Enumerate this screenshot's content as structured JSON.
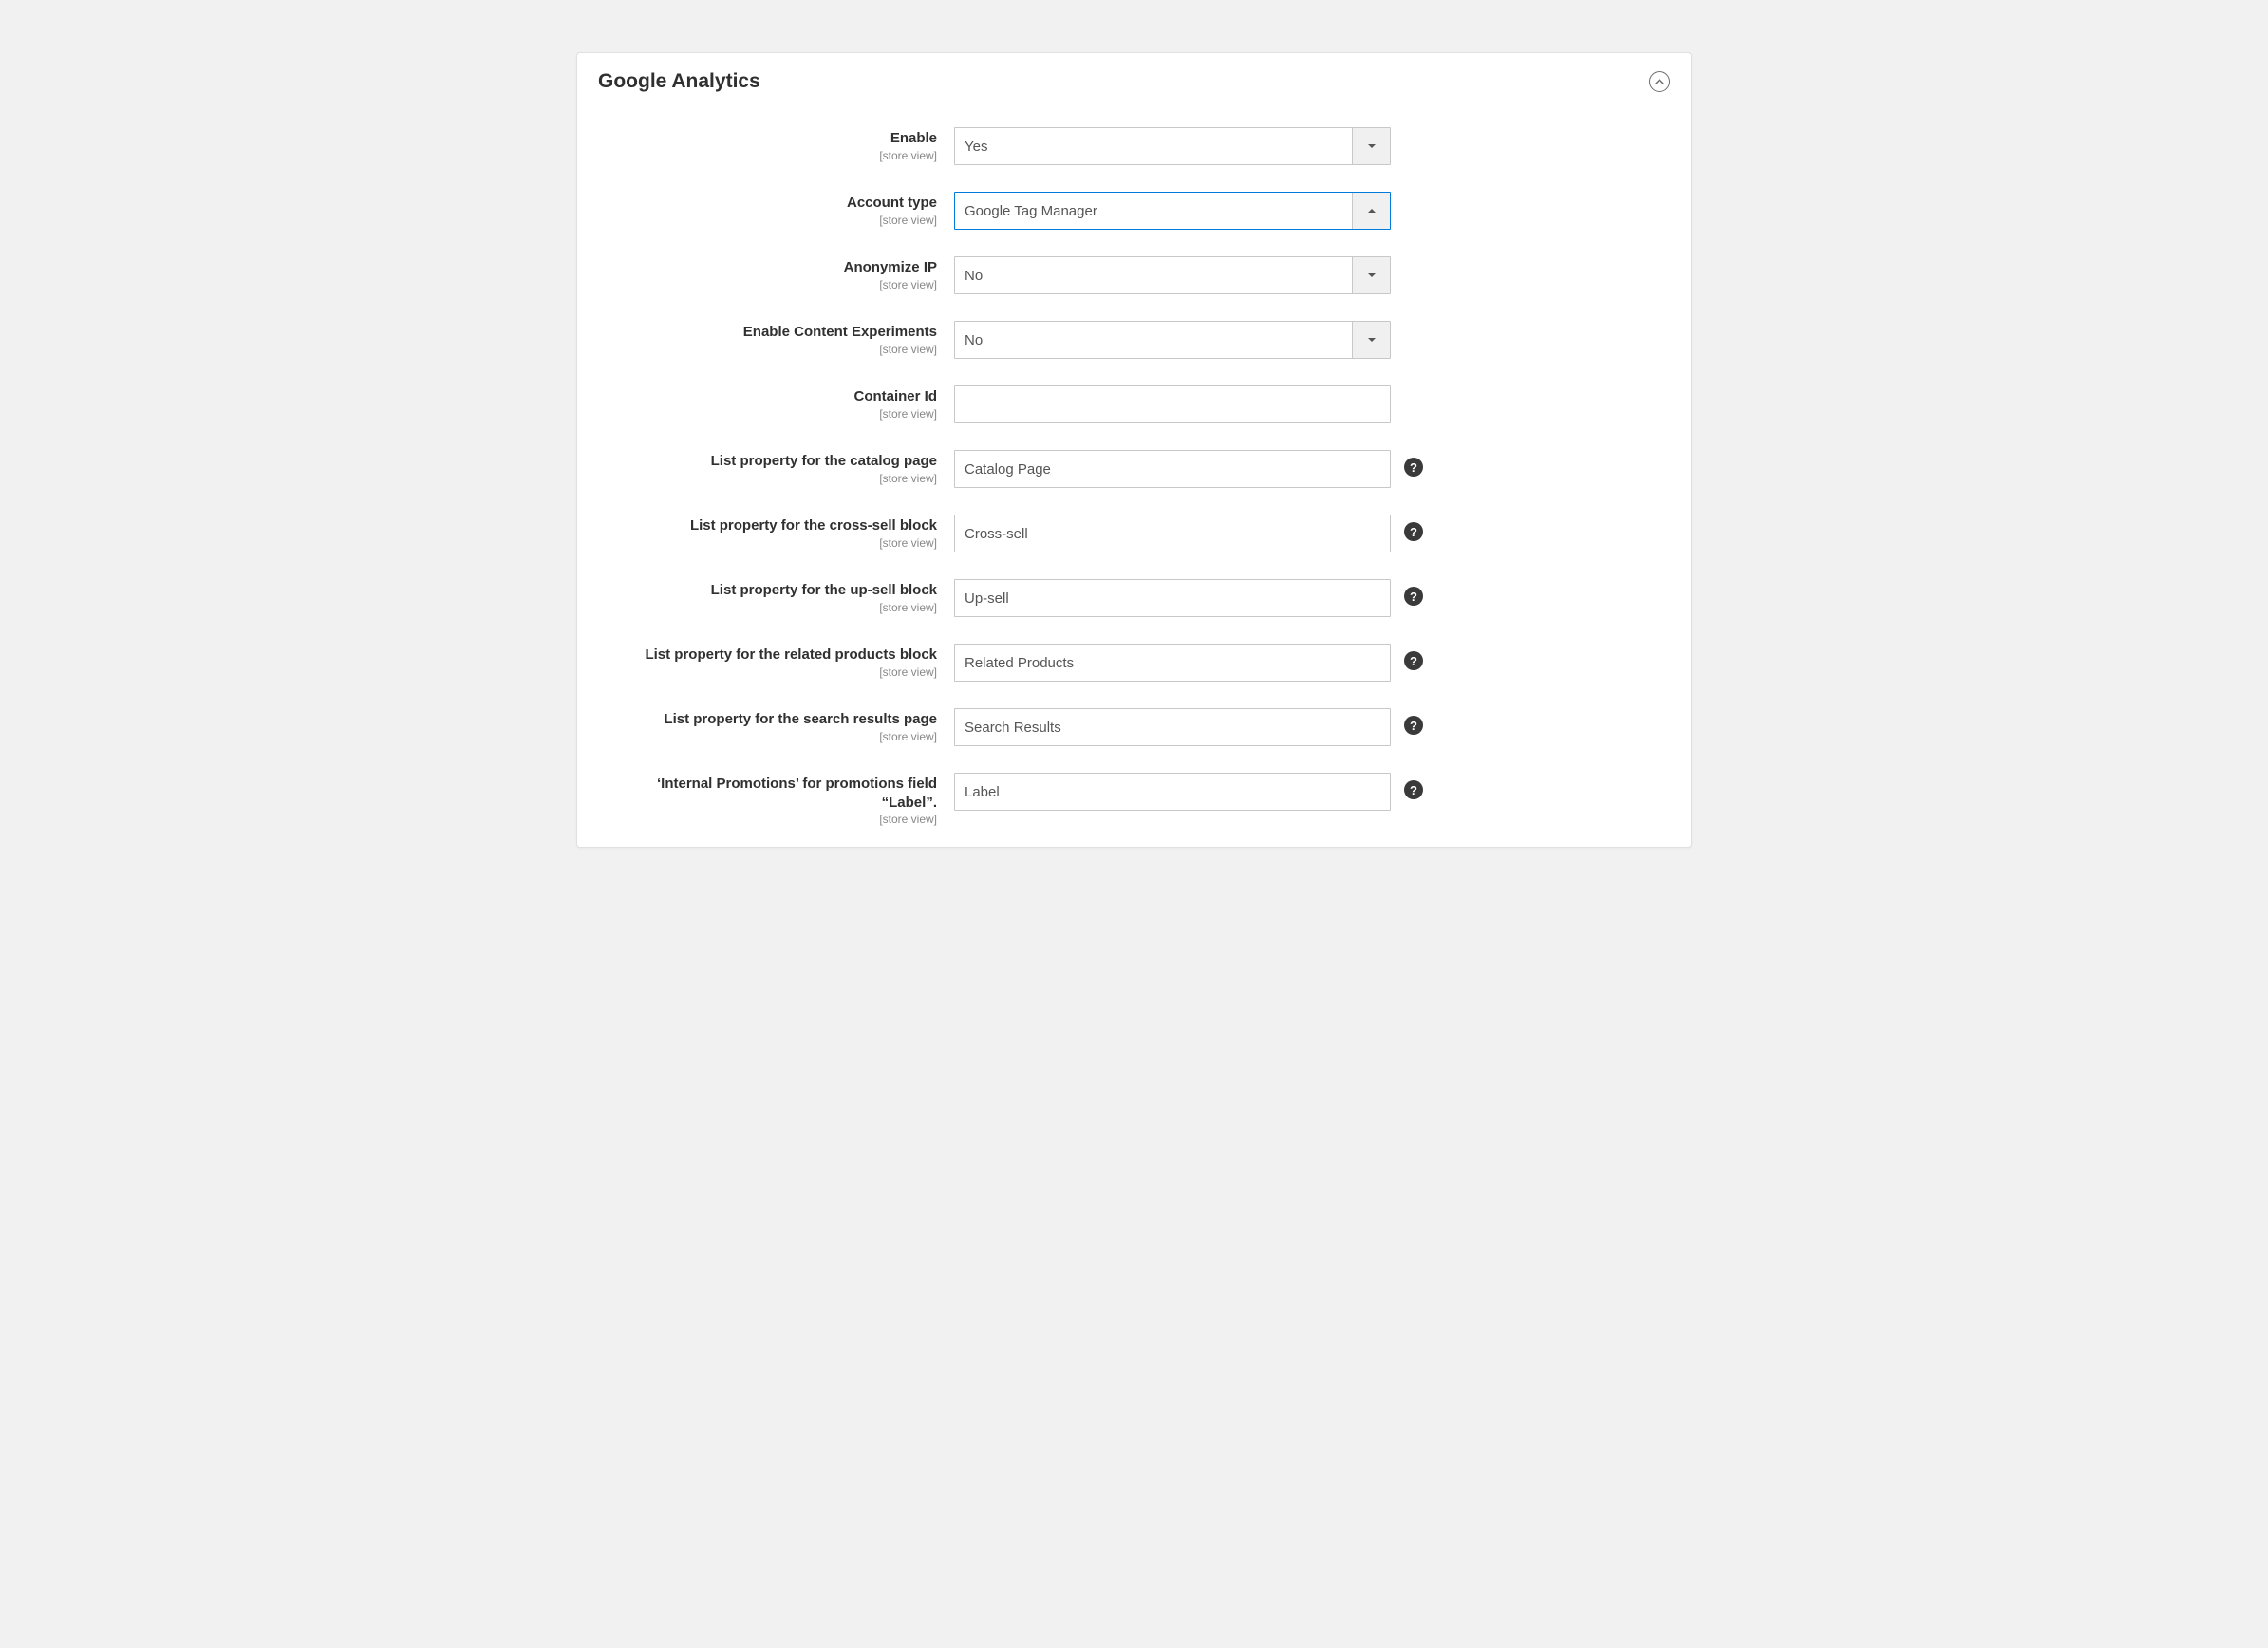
{
  "panel": {
    "title": "Google Analytics"
  },
  "fields": {
    "enable": {
      "label": "Enable",
      "scope": "[store view]",
      "value": "Yes"
    },
    "account_type": {
      "label": "Account type",
      "scope": "[store view]",
      "value": "Google Tag Manager"
    },
    "anonymize_ip": {
      "label": "Anonymize IP",
      "scope": "[store view]",
      "value": "No"
    },
    "content_exp": {
      "label": "Enable Content Experiments",
      "scope": "[store view]",
      "value": "No"
    },
    "container_id": {
      "label": "Container Id",
      "scope": "[store view]",
      "value": ""
    },
    "catalog_page": {
      "label": "List property for the catalog page",
      "scope": "[store view]",
      "value": "Catalog Page"
    },
    "cross_sell": {
      "label": "List property for the cross-sell block",
      "scope": "[store view]",
      "value": "Cross-sell"
    },
    "up_sell": {
      "label": "List property for the up-sell block",
      "scope": "[store view]",
      "value": "Up-sell"
    },
    "related": {
      "label": "List property for the related products block",
      "scope": "[store view]",
      "value": "Related Products"
    },
    "search_results": {
      "label": "List property for the search results page",
      "scope": "[store view]",
      "value": "Search Results"
    },
    "promotions": {
      "label": "‘Internal Promotions’ for promotions field “Label”.",
      "scope": "[store view]",
      "value": "Label"
    }
  },
  "help_char": "?"
}
